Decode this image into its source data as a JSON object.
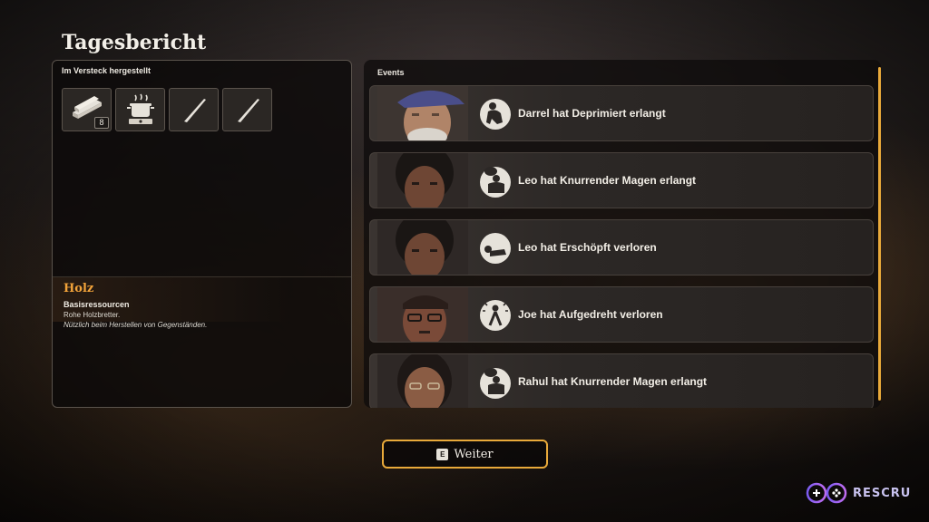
{
  "title": "Tagesbericht",
  "crafted": {
    "label": "Im Versteck hergestellt",
    "items": [
      {
        "icon": "wood-planks-icon",
        "count": "8"
      },
      {
        "icon": "cooking-pot-icon",
        "count": ""
      },
      {
        "icon": "blade-icon",
        "count": ""
      },
      {
        "icon": "blade-icon",
        "count": ""
      }
    ]
  },
  "detail": {
    "name": "Holz",
    "category": "Basisressourcen",
    "description": "Rohe Holzbretter.",
    "note": "Nützlich beim Herstellen von Gegenständen."
  },
  "events": {
    "label": "Events",
    "items": [
      {
        "text": "Darrel hat Deprimiert erlangt",
        "icon": "depressed-icon"
      },
      {
        "text": "Leo hat Knurrender Magen erlangt",
        "icon": "hungry-icon"
      },
      {
        "text": "Leo hat Erschöpft verloren",
        "icon": "exhausted-icon"
      },
      {
        "text": "Joe hat Aufgedreht verloren",
        "icon": "energized-icon"
      },
      {
        "text": "Rahul hat Knurrender Magen erlangt",
        "icon": "hungry-icon"
      }
    ]
  },
  "continue": {
    "key": "E",
    "label": "Weiter"
  },
  "watermark": "RESCRU",
  "colors": {
    "accent": "#e8a93a",
    "item_name": "#f2a33a",
    "watermark": "#c9c3f0"
  }
}
